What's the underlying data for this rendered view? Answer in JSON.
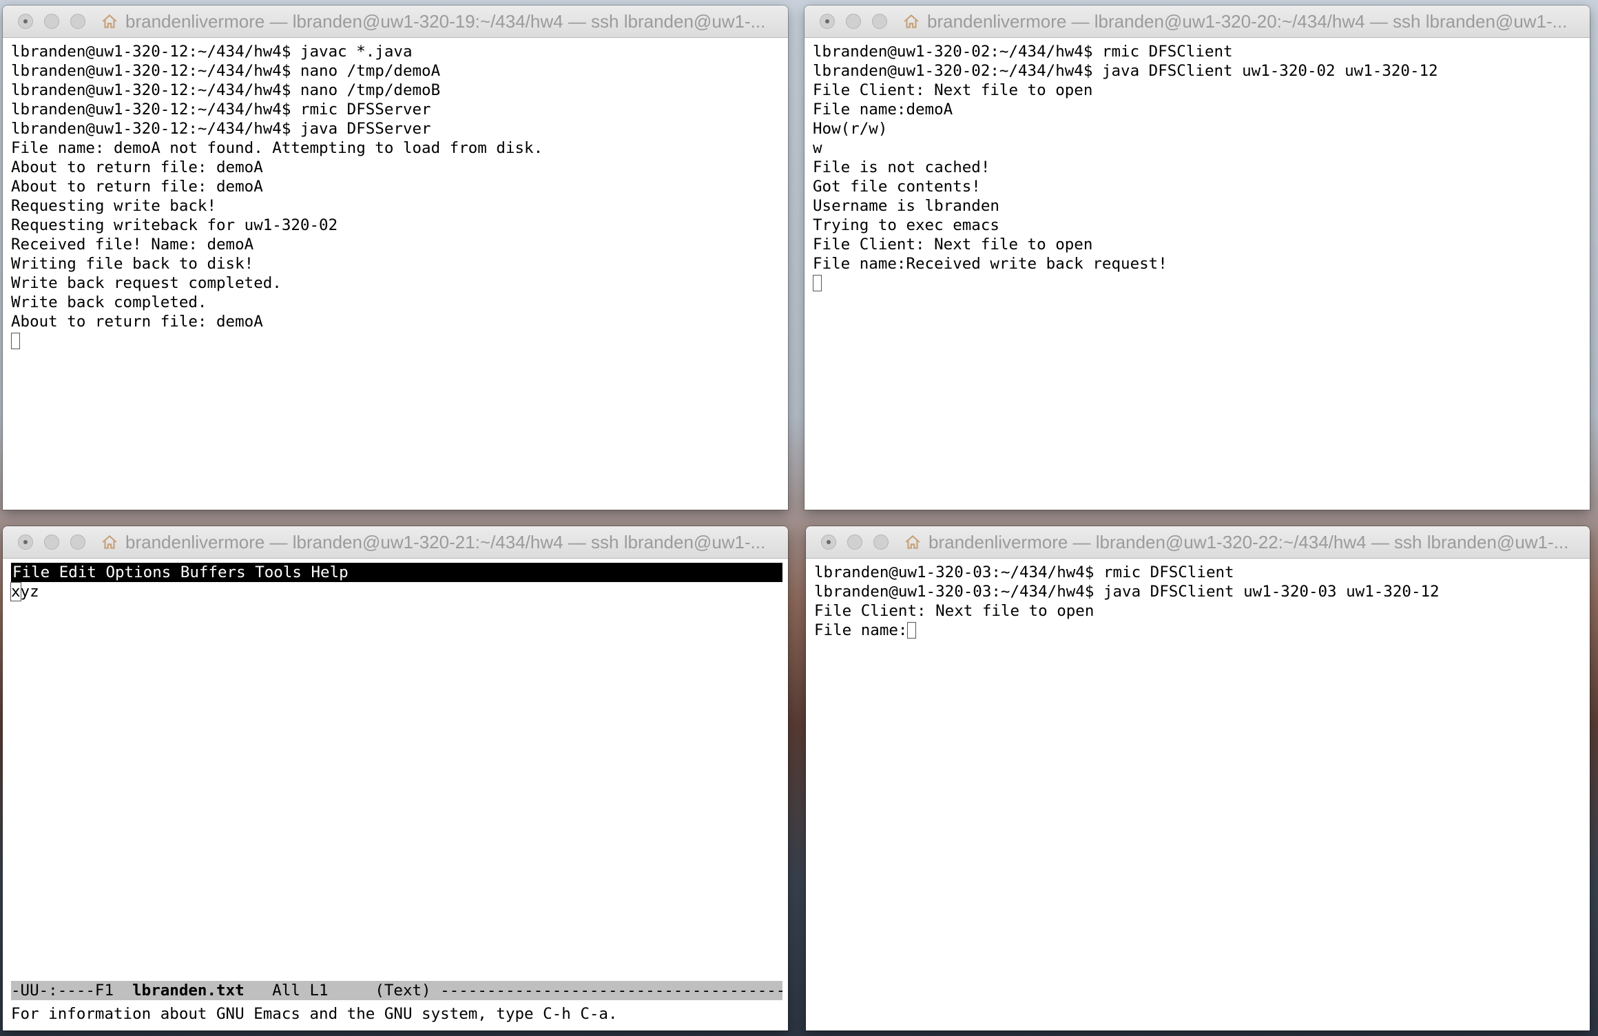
{
  "windows": [
    {
      "id": "tl",
      "title": "brandenlivermore — lbranden@uw1-320-19:~/434/hw4 — ssh lbranden@uw1-...",
      "lines": [
        "lbranden@uw1-320-12:~/434/hw4$ javac *.java",
        "lbranden@uw1-320-12:~/434/hw4$ nano /tmp/demoA",
        "lbranden@uw1-320-12:~/434/hw4$ nano /tmp/demoB",
        "lbranden@uw1-320-12:~/434/hw4$ rmic DFSServer",
        "lbranden@uw1-320-12:~/434/hw4$ java DFSServer",
        "File name: demoA not found. Attempting to load from disk.",
        "About to return file: demoA",
        "About to return file: demoA",
        "Requesting write back!",
        "Requesting writeback for uw1-320-02",
        "Received file! Name: demoA",
        "Writing file back to disk!",
        "Write back request completed.",
        "Write back completed.",
        "About to return file: demoA"
      ]
    },
    {
      "id": "tr",
      "title": "brandenlivermore — lbranden@uw1-320-20:~/434/hw4 — ssh lbranden@uw1-...",
      "lines": [
        "lbranden@uw1-320-02:~/434/hw4$ rmic DFSClient",
        "lbranden@uw1-320-02:~/434/hw4$ java DFSClient uw1-320-02 uw1-320-12",
        "File Client: Next file to open",
        "File name:demoA",
        "How(r/w)",
        "w",
        "File is not cached!",
        "Got file contents!",
        "Username is lbranden",
        "Trying to exec emacs",
        "File Client: Next file to open",
        "File name:Received write back request!"
      ]
    },
    {
      "id": "bl",
      "title": "brandenlivermore — lbranden@uw1-320-21:~/434/hw4 — ssh lbranden@uw1-...",
      "menu": "File Edit Options Buffers Tools Help",
      "buffer_text_first": "x",
      "buffer_text_rest": "yz",
      "modeline_left": "-UU-:----F1  ",
      "modeline_buffer": "lbranden.txt",
      "modeline_right": "   All L1     (Text) -----------------------------------------------",
      "minibuffer": "For information about GNU Emacs and the GNU system, type C-h C-a."
    },
    {
      "id": "br",
      "title": "brandenlivermore — lbranden@uw1-320-22:~/434/hw4 — ssh lbranden@uw1-...",
      "lines": [
        "lbranden@uw1-320-03:~/434/hw4$ rmic DFSClient",
        "lbranden@uw1-320-03:~/434/hw4$ java DFSClient uw1-320-03 uw1-320-12",
        "File Client: Next file to open",
        "File name:"
      ]
    }
  ]
}
